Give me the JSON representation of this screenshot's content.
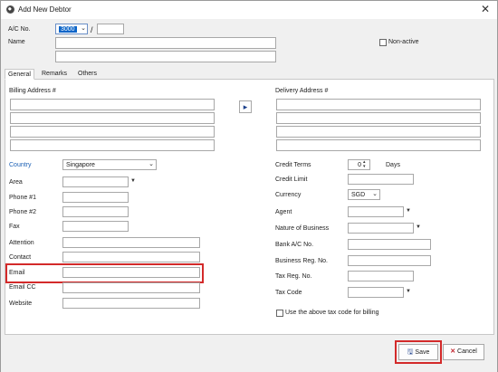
{
  "window": {
    "title": "Add New Debtor"
  },
  "header": {
    "ac_no_label": "A/C No.",
    "ac_no_value": "3000",
    "ac_no_separator": "/",
    "name_label": "Name",
    "non_active_label": "Non-active"
  },
  "tabs": [
    {
      "label": "General",
      "active": true
    },
    {
      "label": "Remarks",
      "active": false
    },
    {
      "label": "Others",
      "active": false
    }
  ],
  "billing": {
    "label": "Billing Address #"
  },
  "delivery": {
    "label": "Delivery Address #",
    "copy_button": "▸"
  },
  "left_fields": {
    "country_label": "Country",
    "country_value": "Singapore",
    "area_label": "Area",
    "phone1_label": "Phone #1",
    "phone2_label": "Phone #2",
    "fax_label": "Fax",
    "attention_label": "Attention",
    "contact_label": "Contact",
    "email_label": "Email",
    "email_cc_label": "Email CC",
    "website_label": "Website"
  },
  "right_fields": {
    "credit_terms_label": "Credit Terms",
    "credit_terms_value": "0",
    "days_label": "Days",
    "credit_limit_label": "Credit Limit",
    "currency_label": "Currency",
    "currency_value": "SGD",
    "agent_label": "Agent",
    "nature_label": "Nature of Business",
    "bank_label": "Bank A/C No.",
    "business_reg_label": "Business Reg. No.",
    "tax_reg_label": "Tax Reg. No.",
    "tax_code_label": "Tax Code",
    "use_tax_code_label": "Use the above tax code for billing"
  },
  "footer": {
    "save_label": "Save",
    "cancel_label": "Cancel"
  },
  "colors": {
    "highlight": "#d32a2a",
    "accent_blue": "#1a5fb4",
    "selection": "#0a64c8"
  }
}
